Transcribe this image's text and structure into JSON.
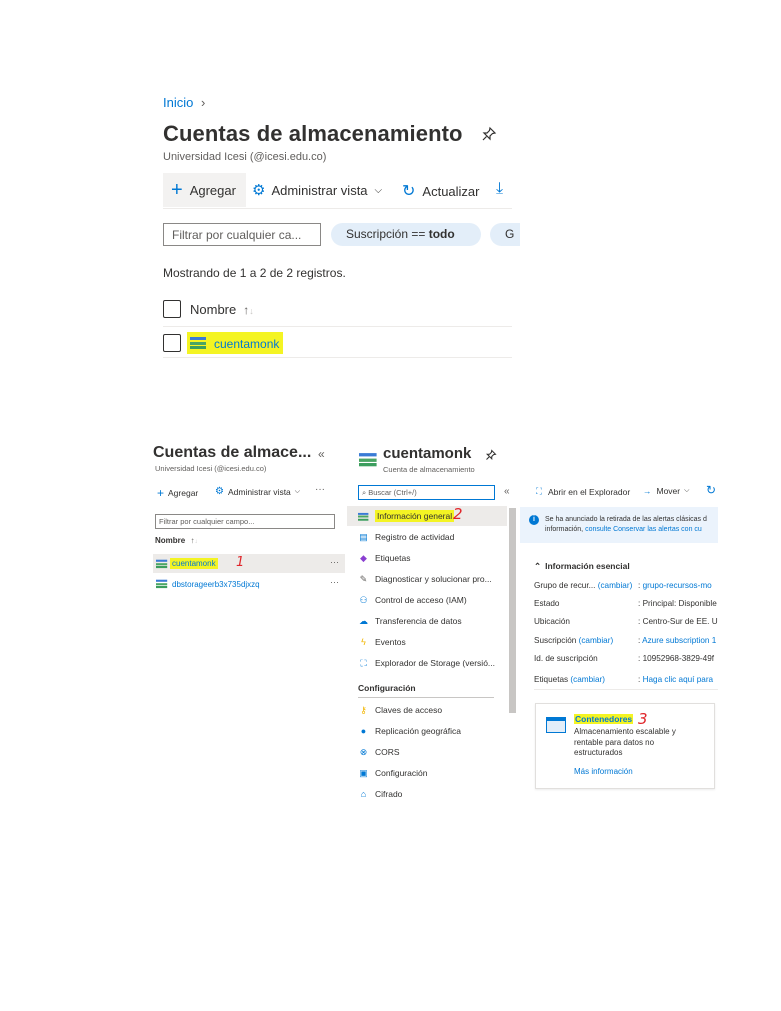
{
  "top": {
    "breadcrumb": "Inicio",
    "title": "Cuentas de almacenamiento",
    "subtitle": "Universidad Icesi (@icesi.edu.co)",
    "toolbar": {
      "add": "Agregar",
      "manage_view": "Administrar vista",
      "refresh": "Actualizar"
    },
    "filter_placeholder": "Filtrar por cualquier ca...",
    "subscription_pill_prefix": "Suscripción == ",
    "subscription_pill_value": "todo",
    "pill2": "G",
    "showing": "Mostrando de 1 a 2 de 2 registros.",
    "col_name": "Nombre",
    "row1": "cuentamonk"
  },
  "bottom": {
    "left": {
      "title": "Cuentas de almace...",
      "subtitle": "Universidad Icesi (@icesi.edu.co)",
      "add": "Agregar",
      "manage_view": "Administrar vista",
      "filter_placeholder": "Filtrar por cualquier campo...",
      "col_name": "Nombre",
      "rows": [
        "cuentamonk",
        "dbstorageerb3x735djxzq"
      ],
      "annot1": "1"
    },
    "mid": {
      "title": "cuentamonk",
      "subtitle": "Cuenta de almacenamiento",
      "search_placeholder": "Buscar (Ctrl+/)",
      "items": [
        "Información general",
        "Registro de actividad",
        "Etiquetas",
        "Diagnosticar y solucionar pro...",
        "Control de acceso (IAM)",
        "Transferencia de datos",
        "Eventos",
        "Explorador de Storage (versió..."
      ],
      "section": "Configuración",
      "config_items": [
        "Claves de acceso",
        "Replicación geográfica",
        "CORS",
        "Configuración",
        "Cifrado"
      ],
      "annot2": "2"
    },
    "right": {
      "open_explorer": "Abrir en el Explorador",
      "move": "Mover",
      "notice": "Se ha anunciado la retirada de las alertas clásicas d",
      "notice2_prefix": "información, ",
      "notice2_link": "consulte Conservar las alertas con cu",
      "essentials": "Información esencial",
      "props": [
        {
          "k": "Grupo de recur...",
          "k_link": "(cambiar)",
          "v": "grupo-recursos-mo",
          "v_link": true
        },
        {
          "k": "Estado",
          "k_link": "",
          "v": "Principal: Disponible",
          "v_link": false
        },
        {
          "k": "Ubicación",
          "k_link": "",
          "v": "Centro-Sur de EE. U",
          "v_link": false
        },
        {
          "k": "Suscripción",
          "k_link": "(cambiar)",
          "v": "Azure subscription 1",
          "v_link": true
        },
        {
          "k": "Id. de suscripción",
          "k_link": "",
          "v": "10952968-3829-49f",
          "v_link": false
        },
        {
          "k": "Etiquetas",
          "k_link": "(cambiar)",
          "v": "Haga clic aquí para",
          "v_link": true
        }
      ],
      "card_title": "Contenedores",
      "card_desc": "Almacenamiento escalable y rentable para datos no estructurados",
      "card_link": "Más información",
      "annot3": "3"
    }
  }
}
